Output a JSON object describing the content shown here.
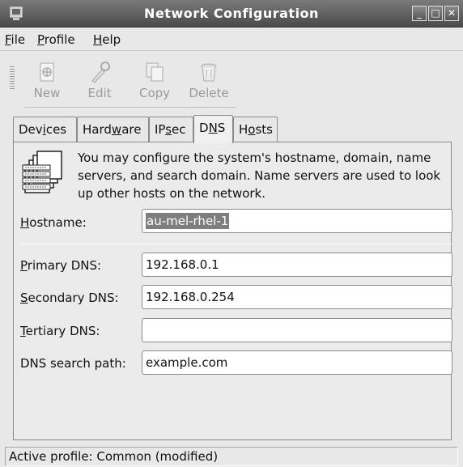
{
  "window": {
    "title": "Network Configuration"
  },
  "menu": [
    {
      "label": "File",
      "mnemonic": "F",
      "rest": "ile"
    },
    {
      "label": "Profile",
      "mnemonic": "P",
      "rest": "rofile"
    },
    {
      "label": "Help",
      "mnemonic": "H",
      "rest": "elp"
    }
  ],
  "toolbar": {
    "new_label": "New",
    "edit_label": "Edit",
    "copy_label": "Copy",
    "delete_label": "Delete"
  },
  "tabs": {
    "devices": {
      "pre": "Dev",
      "mn": "i",
      "post": "ces"
    },
    "hardware": {
      "pre": "Hard",
      "mn": "w",
      "post": "are"
    },
    "ipsec": {
      "pre": "IP",
      "mn": "s",
      "post": "ec"
    },
    "dns": {
      "pre": "D",
      "mn": "N",
      "post": "S"
    },
    "hosts": {
      "pre": "H",
      "mn": "o",
      "post": "sts"
    }
  },
  "dns": {
    "info": "You may configure the system's hostname, domain, name servers, and search domain. Name servers are used to look up other hosts on the network.",
    "hostname": {
      "mn": "H",
      "rest": "ostname:",
      "value": "au-mel-rhel-1"
    },
    "primary": {
      "mn": "P",
      "rest": "rimary DNS:",
      "value": "192.168.0.1"
    },
    "secondary": {
      "mn": "S",
      "rest": "econdary DNS:",
      "value": "192.168.0.254"
    },
    "tertiary": {
      "mn": "T",
      "rest": "ertiary DNS:",
      "value": ""
    },
    "search": {
      "label": "DNS search path:",
      "value": "example.com"
    }
  },
  "status": {
    "text": "Active profile: Common (modified)"
  },
  "icons": {
    "app": "network-config-icon",
    "new": "new-icon",
    "edit": "edit-icon",
    "copy": "copy-icon",
    "delete": "delete-icon",
    "dns_info": "address-book-icon"
  }
}
